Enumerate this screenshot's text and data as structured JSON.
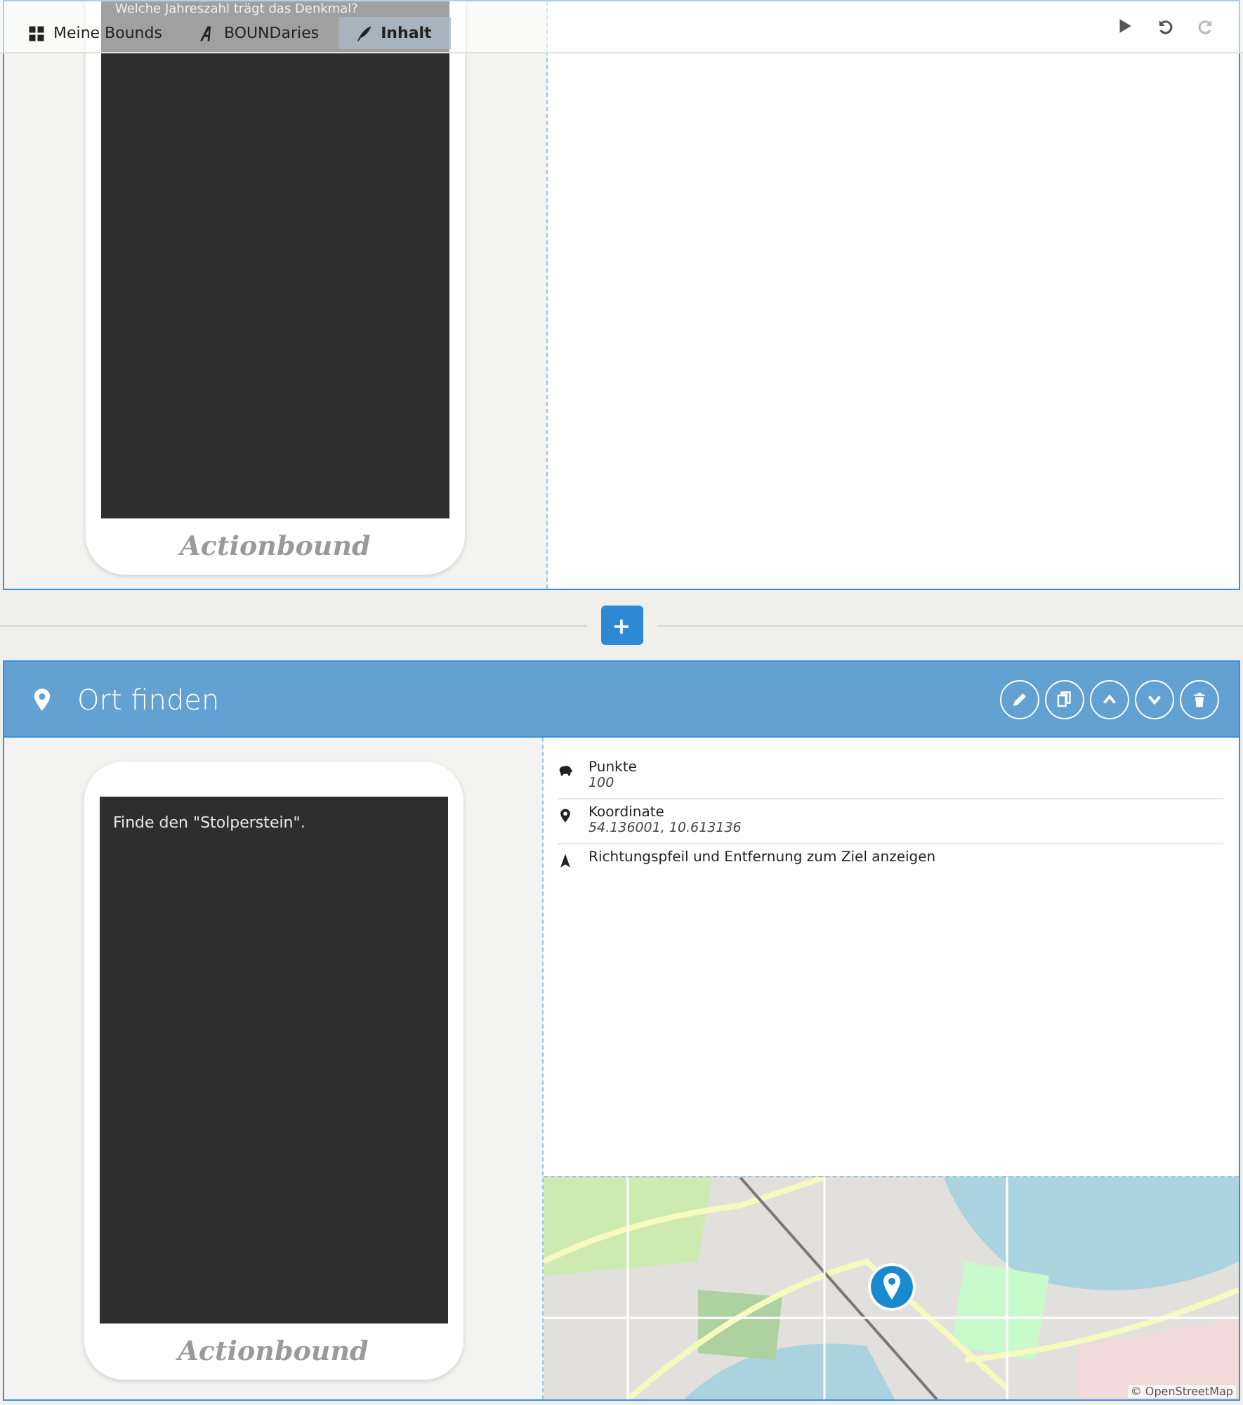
{
  "toolbar": {
    "breadcrumbs": [
      {
        "kind": "grid",
        "label": "Meine Bounds",
        "selected": false
      },
      {
        "kind": "letter",
        "label": "BOUNDaries",
        "selected": false
      },
      {
        "kind": "quill",
        "label": "Inhalt",
        "selected": true
      }
    ],
    "actions": [
      {
        "kind": "play",
        "disabled": false
      },
      {
        "kind": "undo",
        "disabled": false
      },
      {
        "kind": "redo",
        "disabled": true
      }
    ]
  },
  "cards": [
    {
      "phone": {
        "screen_text": "Welche Jahreszahl trägt das Denkmal?",
        "brand": "Actionbound"
      }
    },
    {
      "header": {
        "title": "Ort finden",
        "buttons": [
          {
            "kind": "edit"
          },
          {
            "kind": "copy"
          },
          {
            "kind": "up"
          },
          {
            "kind": "down"
          },
          {
            "kind": "delete"
          }
        ]
      },
      "phone": {
        "screen_text": "Finde den \"Stolperstein\".",
        "brand": "Actionbound"
      },
      "properties": [
        {
          "kind": "piggy",
          "label": "Punkte",
          "value": "100"
        },
        {
          "kind": "pin",
          "label": "Koordinate",
          "value": "54.136001, 10.613136"
        },
        {
          "kind": "arrow",
          "label": "Richtungspfeil und Entfernung zum Ziel anzeigen"
        }
      ],
      "map": {
        "attribution": "© OpenStreetMap"
      }
    }
  ],
  "add_button": {
    "label": "+"
  }
}
